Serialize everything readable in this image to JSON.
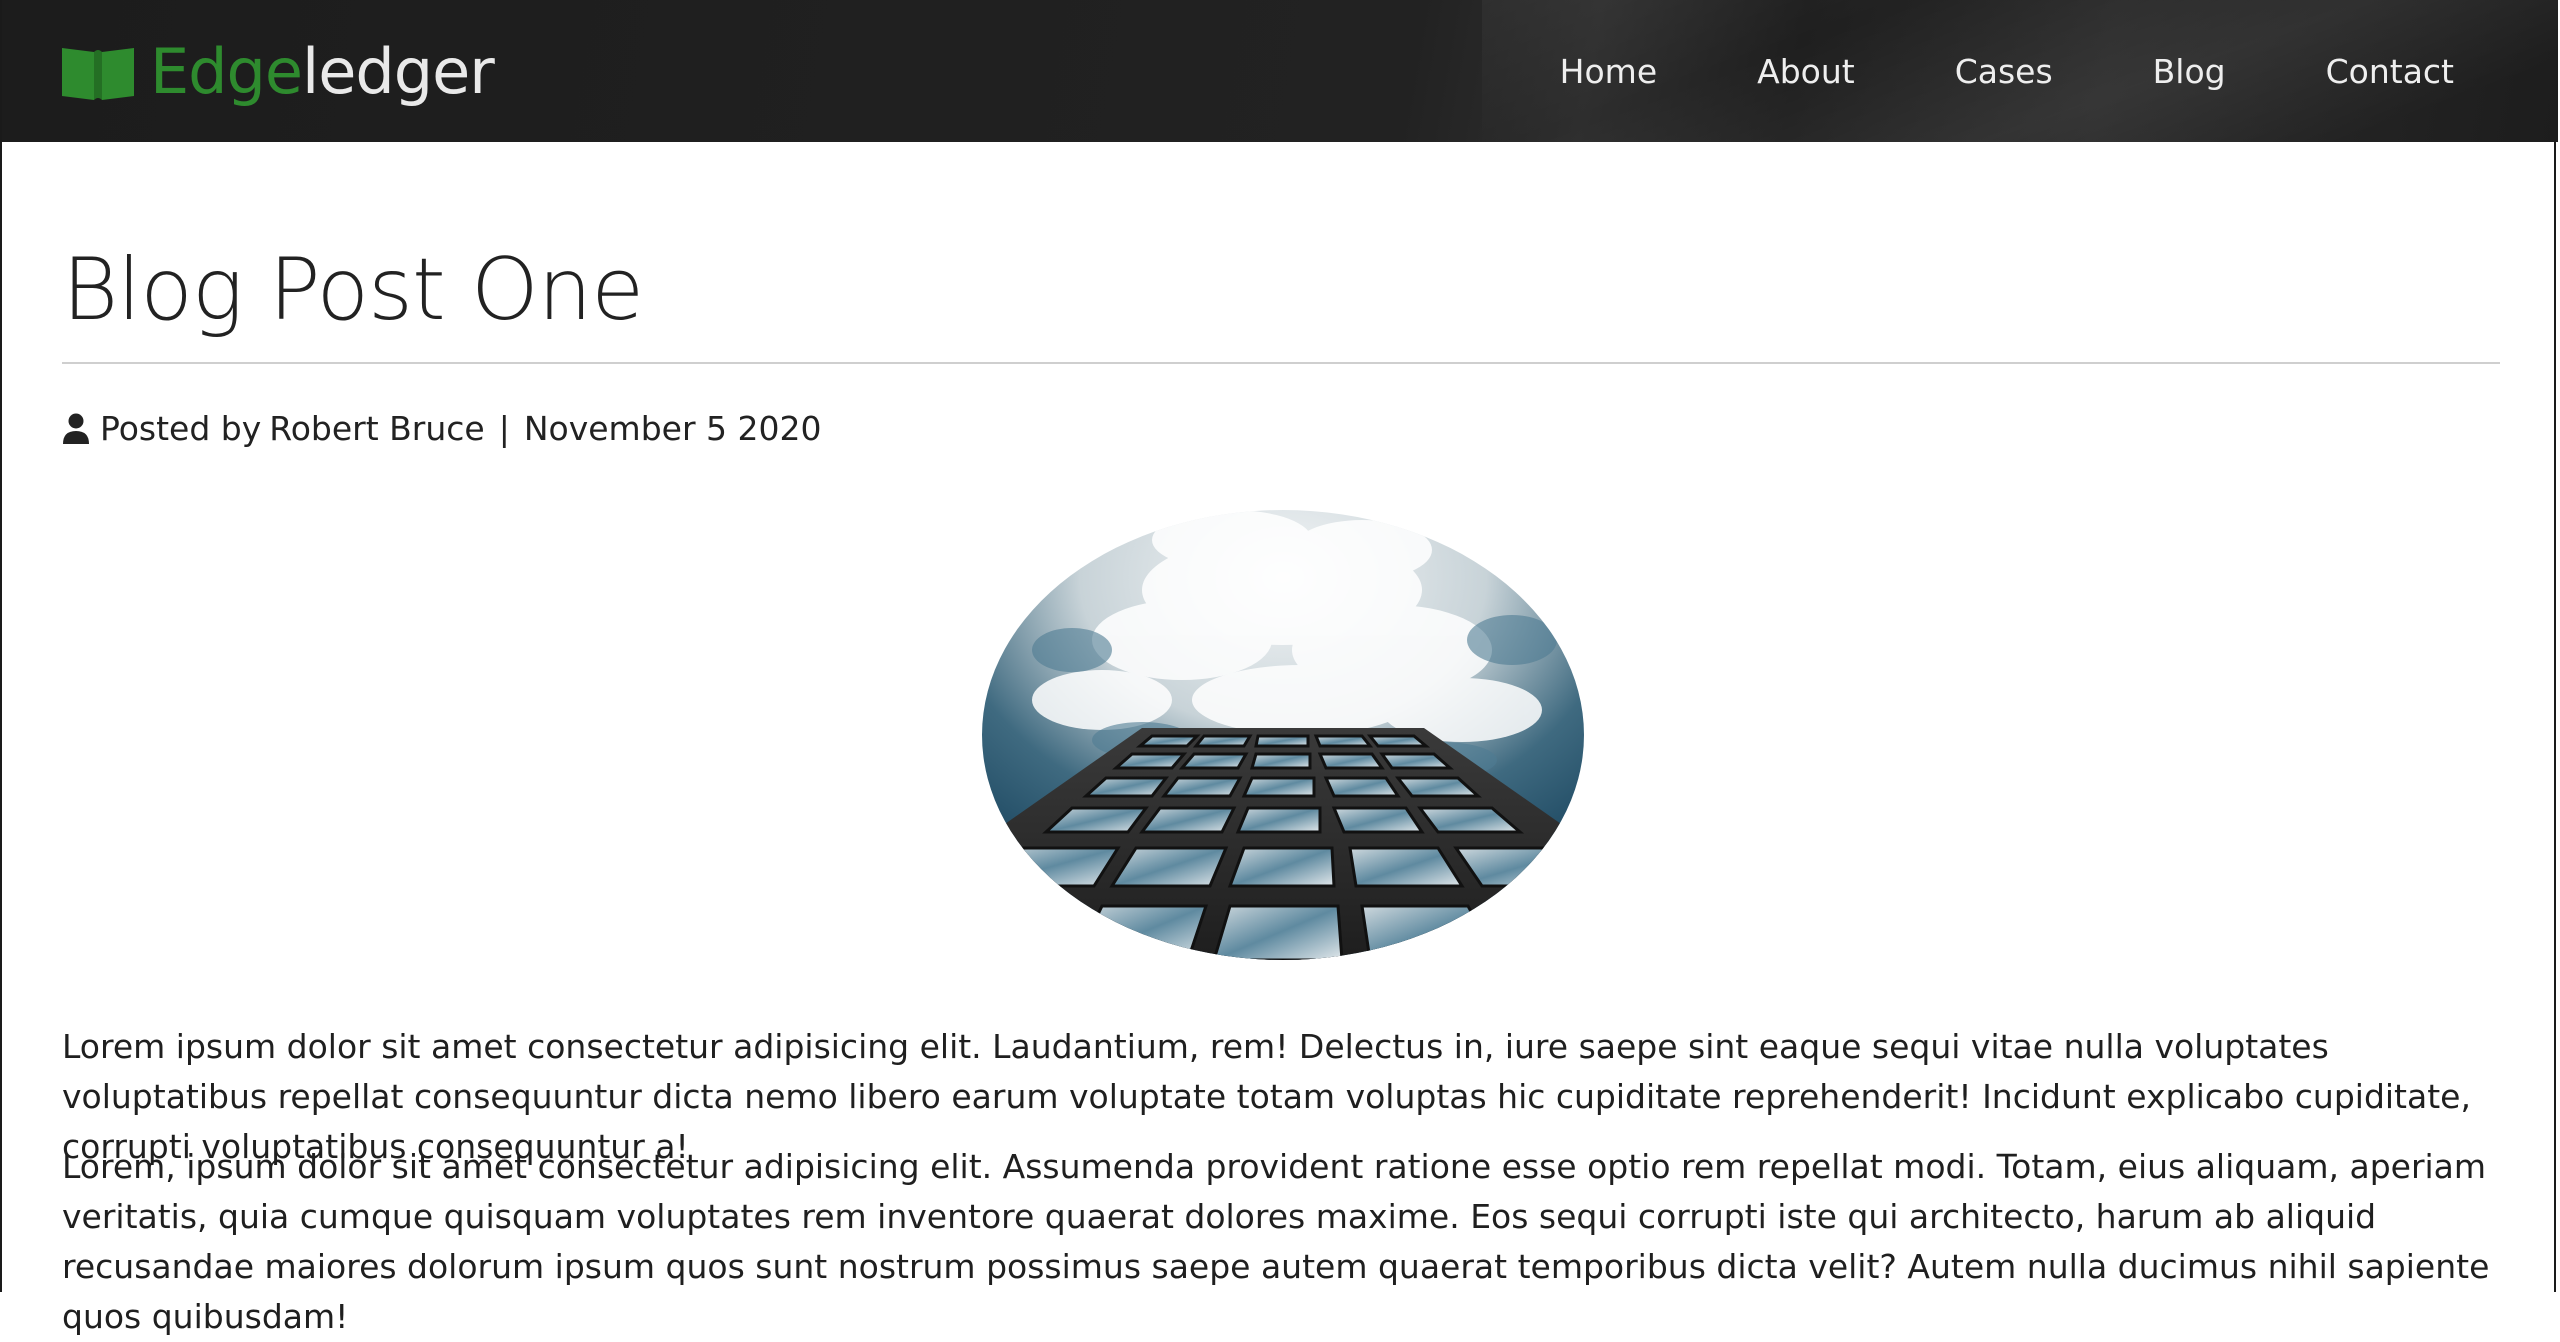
{
  "brand": {
    "name_part1": "Edge",
    "name_part2": "ledger",
    "icon": "book-icon",
    "accent_color": "#2e8b2e"
  },
  "nav": {
    "items": [
      {
        "label": "Home"
      },
      {
        "label": "About"
      },
      {
        "label": "Cases"
      },
      {
        "label": "Blog"
      },
      {
        "label": "Contact"
      }
    ]
  },
  "post": {
    "title": "Blog Post One",
    "posted_by_label": "Posted by",
    "author": "Robert Bruce",
    "separator": "|",
    "date": "November 5 2020",
    "user_icon": "user-icon",
    "image_alt": "building-looking-up-at-clouds",
    "paragraphs": [
      "Lorem ipsum dolor sit amet consectetur adipisicing elit. Laudantium, rem! Delectus in, iure saepe sint eaque sequi vitae nulla voluptates voluptatibus repellat consequuntur dicta nemo libero earum voluptate totam voluptas hic cupiditate reprehenderit! Incidunt explicabo cupiditate, corrupti voluptatibus consequuntur a!",
      "Lorem, ipsum dolor sit amet consectetur adipisicing elit. Assumenda provident ratione esse optio rem repellat modi. Totam, eius aliquam, aperiam veritatis, quia cumque quisquam voluptates rem inventore quaerat dolores maxime. Eos sequi corrupti iste qui architecto, harum ab aliquid recusandae maiores dolorum ipsum quos sunt nostrum possimus saepe autem quaerat temporibus dicta velit? Autem nulla ducimus nihil sapiente quos quibusdam!"
    ]
  }
}
